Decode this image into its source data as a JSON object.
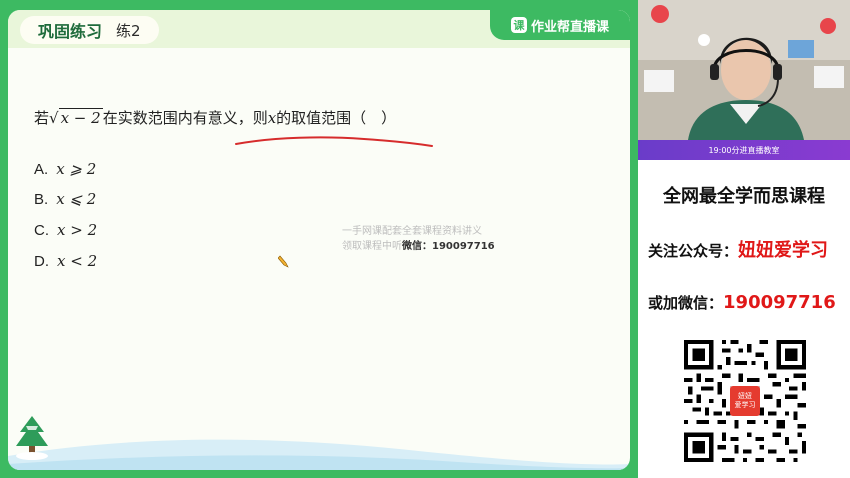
{
  "header": {
    "title": "巩固练习",
    "subtitle": "练2",
    "brand_logo": "课",
    "brand_name": "作业帮直播课"
  },
  "question": {
    "prefix": "若",
    "radicand": "x − 2",
    "text_middle": "在实数范围内有意义，则",
    "variable": "x",
    "text_end": "的取值范围（　）",
    "underline_color": "#d62c2c"
  },
  "options": [
    {
      "letter": "A.",
      "expr": "x ⩾ 2"
    },
    {
      "letter": "B.",
      "expr": "x ⩽ 2"
    },
    {
      "letter": "C.",
      "expr": "x > 2"
    },
    {
      "letter": "D.",
      "expr": "x < 2"
    }
  ],
  "watermark": {
    "line1": "一手网课配套全套课程资料讲义",
    "line2_prefix": "领取课程中听",
    "line2_wechat": "微信：190097716"
  },
  "video": {
    "caption": "19:00分进直播教室"
  },
  "promo": {
    "title": "全网最全学而思课程",
    "account_label": "关注公众号：",
    "account_name": "妞妞爱学习",
    "wechat_label": "或加微信：",
    "wechat_id": "190097716",
    "badge_line1": "妞妞",
    "badge_line2": "爱学习"
  },
  "colors": {
    "frame_green": "#3dba62",
    "title_green": "#1e6b3b",
    "accent_red": "#e01818"
  }
}
